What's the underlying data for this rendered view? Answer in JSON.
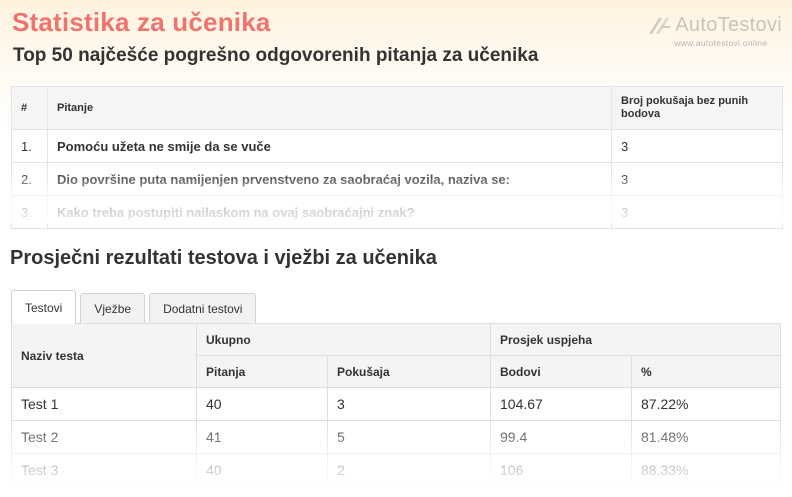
{
  "header": {
    "title": "Statistika za učenika",
    "subtitle": "Top 50 najčešće pogrešno odgovorenih pitanja za učenika",
    "logo_text": "AutoTestovi",
    "logo_url": "www.autotestovi.online"
  },
  "top_questions": {
    "columns": [
      "#",
      "Pitanje",
      "Broj pokušaja bez punih bodova"
    ],
    "rows": [
      {
        "num": "1.",
        "question": "Pomoću užeta ne smije da se vuče",
        "count": "3"
      },
      {
        "num": "2.",
        "question": "Dio površine puta namijenjen prvenstveno za saobraćaj vozila, naziva se:",
        "count": "3"
      },
      {
        "num": "3.",
        "question": "Kako treba postupiti nailaskom na ovaj saobraćajni znak?",
        "count": "3"
      }
    ]
  },
  "results": {
    "title": "Prosječni rezultati testova i vježbi za učenika",
    "tabs": [
      {
        "label": "Testovi",
        "active": true
      },
      {
        "label": "Vježbe",
        "active": false
      },
      {
        "label": "Dodatni testovi",
        "active": false
      }
    ],
    "headers": {
      "name": "Naziv testa",
      "total": "Ukupno",
      "avg": "Prosjek uspjeha",
      "questions": "Pitanja",
      "attempts": "Pokušaja",
      "points": "Bodovi",
      "percent": "%"
    },
    "rows": [
      {
        "name": "Test 1",
        "questions": "40",
        "attempts": "3",
        "points": "104.67",
        "percent": "87.22%"
      },
      {
        "name": "Test 2",
        "questions": "41",
        "attempts": "5",
        "points": "99.4",
        "percent": "81.48%"
      },
      {
        "name": "Test 3",
        "questions": "40",
        "attempts": "2",
        "points": "106",
        "percent": "88.33%"
      }
    ]
  },
  "colors": {
    "title": "#f0746e",
    "header_bg": "#fff3df",
    "logo": "#c9c4bc"
  }
}
